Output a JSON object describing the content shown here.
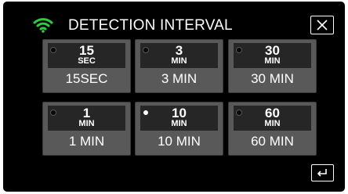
{
  "header": {
    "title": "DETECTION INTERVAL",
    "wifi_icon": "wifi-icon",
    "close_icon": "close-icon"
  },
  "options": [
    {
      "icon_value": "15",
      "icon_unit": "SEC",
      "label": "15SEC",
      "selected": false
    },
    {
      "icon_value": "3",
      "icon_unit": "MIN",
      "label": "3 MIN",
      "selected": false
    },
    {
      "icon_value": "30",
      "icon_unit": "MIN",
      "label": "30 MIN",
      "selected": false
    },
    {
      "icon_value": "1",
      "icon_unit": "MIN",
      "label": "1 MIN",
      "selected": false
    },
    {
      "icon_value": "10",
      "icon_unit": "MIN",
      "label": "10 MIN",
      "selected": true
    },
    {
      "icon_value": "60",
      "icon_unit": "MIN",
      "label": "60 MIN",
      "selected": false
    }
  ],
  "footer": {
    "back_icon": "back-arrow-icon"
  },
  "colors": {
    "wifi_green": "#2ecc40",
    "tile_bg": "#595959",
    "screen_bg": "#000000"
  }
}
